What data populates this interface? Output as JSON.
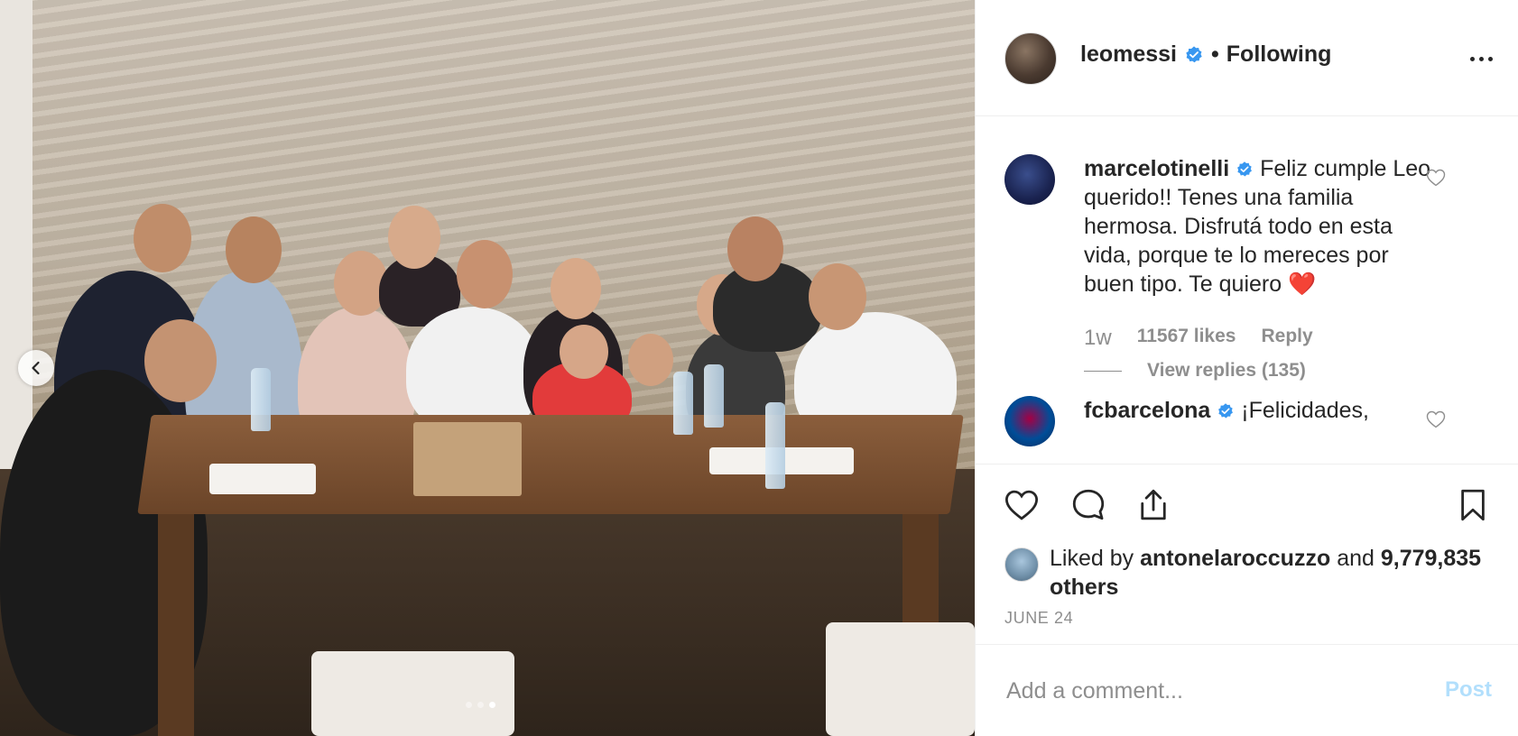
{
  "photo": {
    "carousel_dots": 3,
    "active_dot": 3
  },
  "header": {
    "username": "leomessi",
    "separator": "•",
    "follow_status": "Following"
  },
  "comments": [
    {
      "username": "marcelotinelli",
      "text": "Feliz cumple Leo querido!! Tenes una familia hermosa. Disfrutá todo en esta vida, porque te lo mereces por buen tipo. Te quiero ❤️",
      "time": "1w",
      "likes": "11567 likes",
      "reply_label": "Reply",
      "view_replies": "View replies (135)"
    },
    {
      "username": "fcbarcelona",
      "text": "¡Felicidades,"
    }
  ],
  "likes": {
    "prefix": "Liked by",
    "liker": "antonelaroccuzzo",
    "joiner": "and",
    "others": "9,779,835 others"
  },
  "post_date": "JUNE 24",
  "add_comment": {
    "placeholder": "Add a comment...",
    "post_label": "Post"
  },
  "colors": {
    "verified": "#3897f0",
    "heart_red": "#ed4956",
    "post_disabled": "#b2dffc",
    "secondary_text": "#8e8e8e"
  },
  "icons": [
    "chevron-left-icon",
    "verified-badge-icon",
    "more-options-icon",
    "heart-outline-icon",
    "comment-icon",
    "share-icon",
    "bookmark-icon"
  ]
}
